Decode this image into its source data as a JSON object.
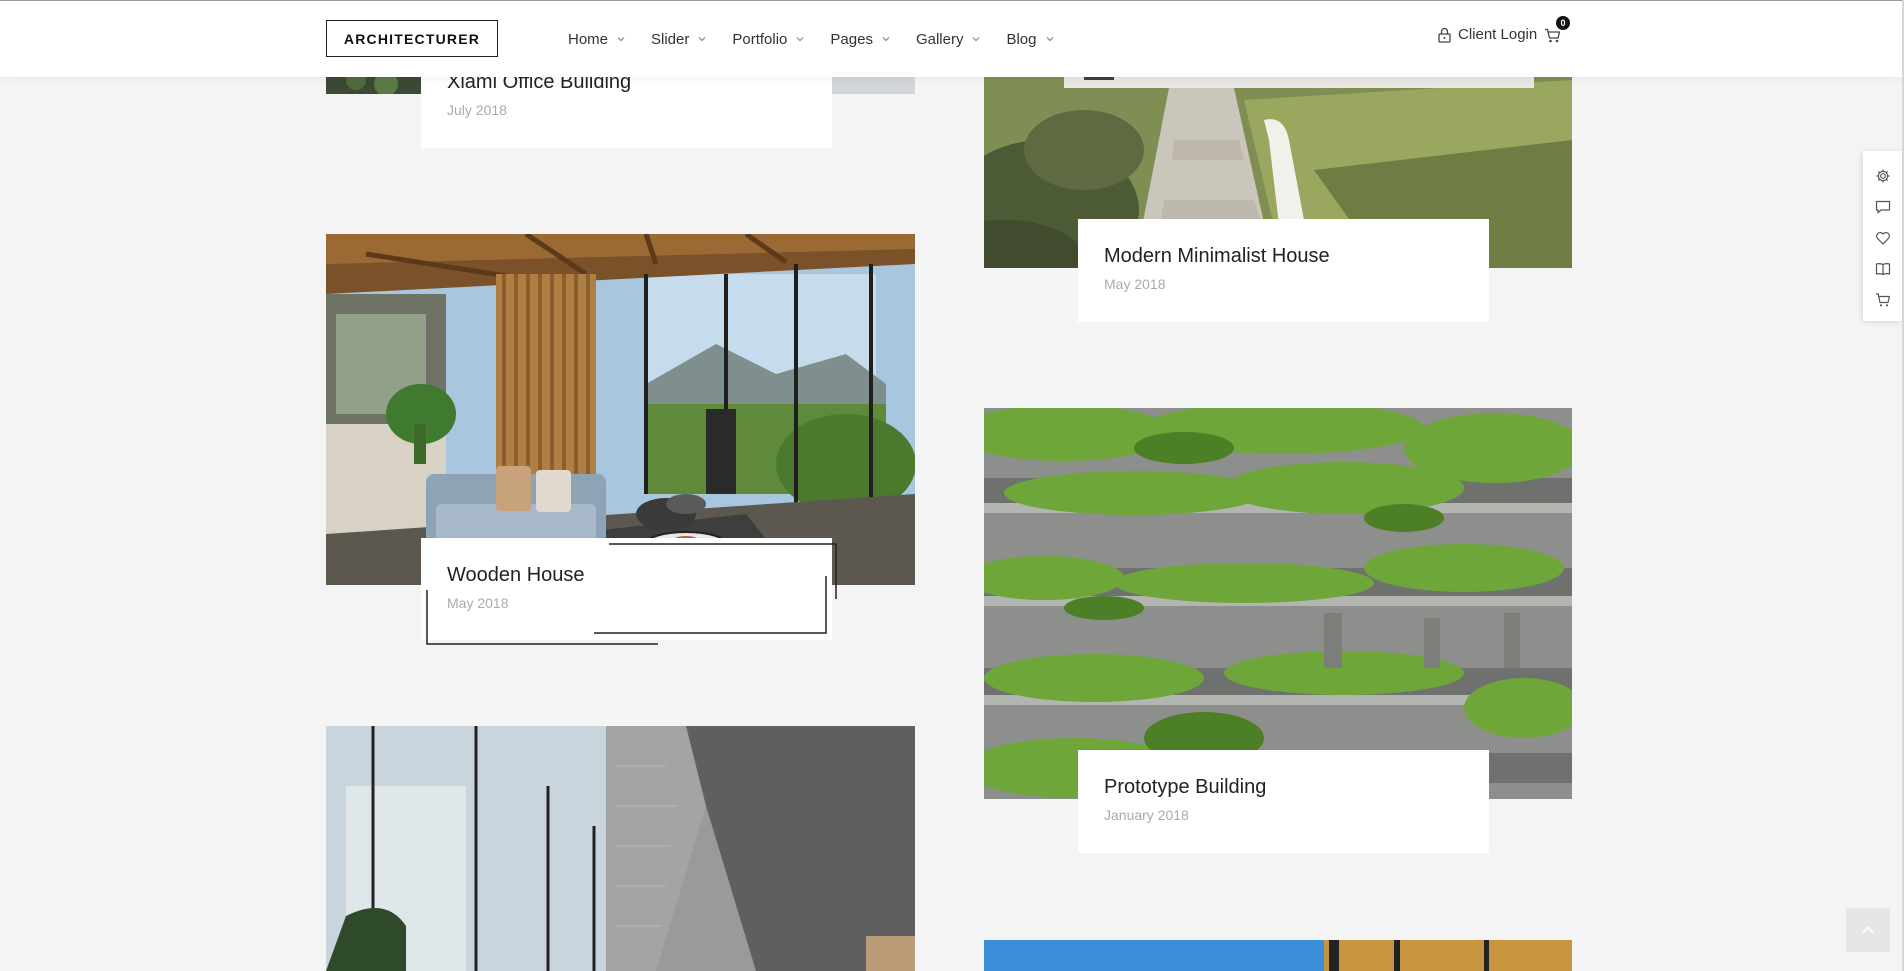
{
  "header": {
    "logo": "ARCHITECTURER",
    "nav": [
      {
        "label": "Home"
      },
      {
        "label": "Slider"
      },
      {
        "label": "Portfolio"
      },
      {
        "label": "Pages"
      },
      {
        "label": "Gallery"
      },
      {
        "label": "Blog"
      }
    ],
    "client_login": "Client Login",
    "cart_count": "0"
  },
  "projects": [
    {
      "title": "Xiami Office Building",
      "date": "July 2018"
    },
    {
      "title": "Modern Minimalist House",
      "date": "May 2018"
    },
    {
      "title": "Wooden House",
      "date": "May 2018"
    },
    {
      "title": "Prototype Building",
      "date": "January 2018"
    }
  ],
  "side_panel": {
    "icons": [
      "gear-icon",
      "comment-icon",
      "heart-icon",
      "book-icon",
      "cart-icon"
    ]
  },
  "colors": {
    "background": "#f4f4f4",
    "card": "#ffffff",
    "text": "#222222",
    "date": "#aaaaaa"
  }
}
